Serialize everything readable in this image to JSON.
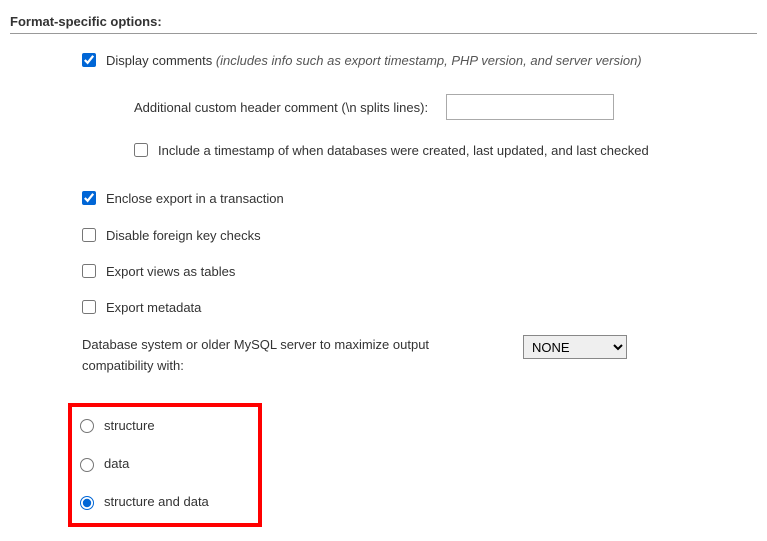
{
  "fieldset_title": "Format-specific options:",
  "display_comments": {
    "label": "Display comments",
    "hint": "(includes info such as export timestamp, PHP version, and server version)",
    "checked": true
  },
  "additional_header": {
    "label": "Additional custom header comment (\\n splits lines):",
    "value": ""
  },
  "include_timestamp": {
    "label": "Include a timestamp of when databases were created, last updated, and last checked",
    "checked": false
  },
  "enclose_transaction": {
    "label": "Enclose export in a transaction",
    "checked": true
  },
  "disable_fk": {
    "label": "Disable foreign key checks",
    "checked": false
  },
  "export_views": {
    "label": "Export views as tables",
    "checked": false
  },
  "export_metadata": {
    "label": "Export metadata",
    "checked": false
  },
  "compatibility": {
    "label": "Database system or older MySQL server to maximize output compatibility with:",
    "selected": "NONE"
  },
  "dump_radio": {
    "options": {
      "structure": "structure",
      "data": "data",
      "both": "structure and data"
    },
    "selected": "both"
  }
}
